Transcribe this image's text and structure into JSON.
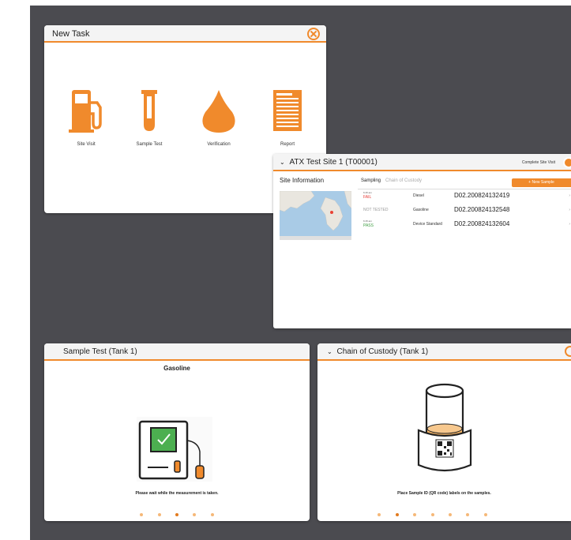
{
  "new_task": {
    "title": "New Task",
    "options": [
      {
        "label": "Site Visit",
        "icon": "fuel-pump-icon"
      },
      {
        "label": "Sample Test",
        "icon": "test-tube-icon"
      },
      {
        "label": "Verification",
        "icon": "drop-icon"
      },
      {
        "label": "Report",
        "icon": "report-icon"
      }
    ]
  },
  "atx": {
    "title": "ATX Test Site 1 (T00001)",
    "complete_label": "Complete Site Visit",
    "site_info_label": "Site Information",
    "tabs": [
      "Sampling",
      "Chain of Custody"
    ],
    "new_sample_label": "+ New Sample",
    "samples": [
      {
        "time": "6:15 am",
        "status": "FAIL",
        "fuel": "Diesel",
        "id": "D02.200824132419"
      },
      {
        "time": "",
        "status": "NOT TESTED",
        "fuel": "Gasoline",
        "id": "D02.200824132548"
      },
      {
        "time": "6:15 am",
        "status": "PASS",
        "fuel": "Device Standard",
        "id": "D02.200824132604"
      }
    ]
  },
  "sample_test": {
    "title": "Sample Test (Tank 1)",
    "fuel": "Gasoline",
    "caption": "Please wait while the measurement is taken.",
    "dots_total": 5,
    "dots_active": 2
  },
  "chain_of_custody": {
    "title": "Chain of Custody (Tank 1)",
    "caption": "Place Sample ID (QR code) labels on the samples.",
    "dots_total": 7,
    "dots_active": 1
  },
  "colors": {
    "accent": "#f08a2c",
    "background": "#4b4b50",
    "fail": "#e53935",
    "pass": "#43a047"
  }
}
